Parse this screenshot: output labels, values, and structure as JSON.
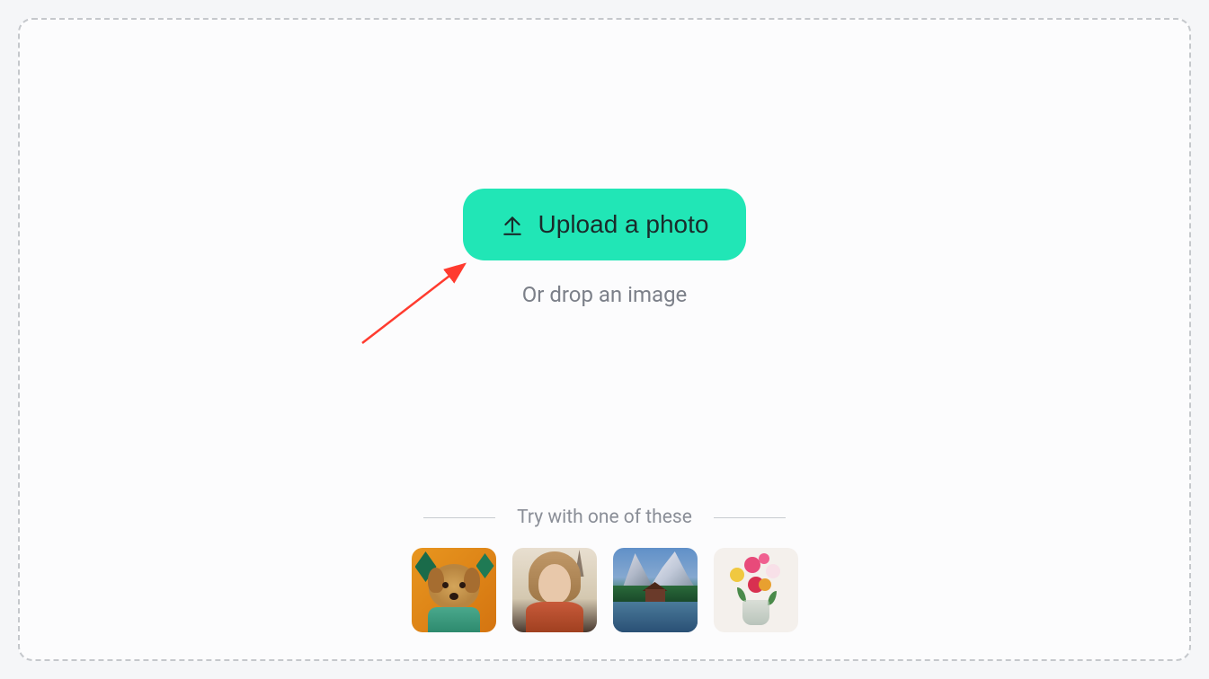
{
  "upload": {
    "button_label": "Upload a photo",
    "drop_hint": "Or drop an image"
  },
  "samples": {
    "heading": "Try with one of these",
    "items": [
      {
        "name": "dog"
      },
      {
        "name": "woman"
      },
      {
        "name": "mountains"
      },
      {
        "name": "flowers"
      }
    ]
  },
  "colors": {
    "accent": "#21e6b6",
    "border": "#c5c8cc",
    "text_muted": "#7c8089"
  },
  "annotation": {
    "type": "arrow",
    "color": "#ff3b2f",
    "target": "upload-button"
  }
}
